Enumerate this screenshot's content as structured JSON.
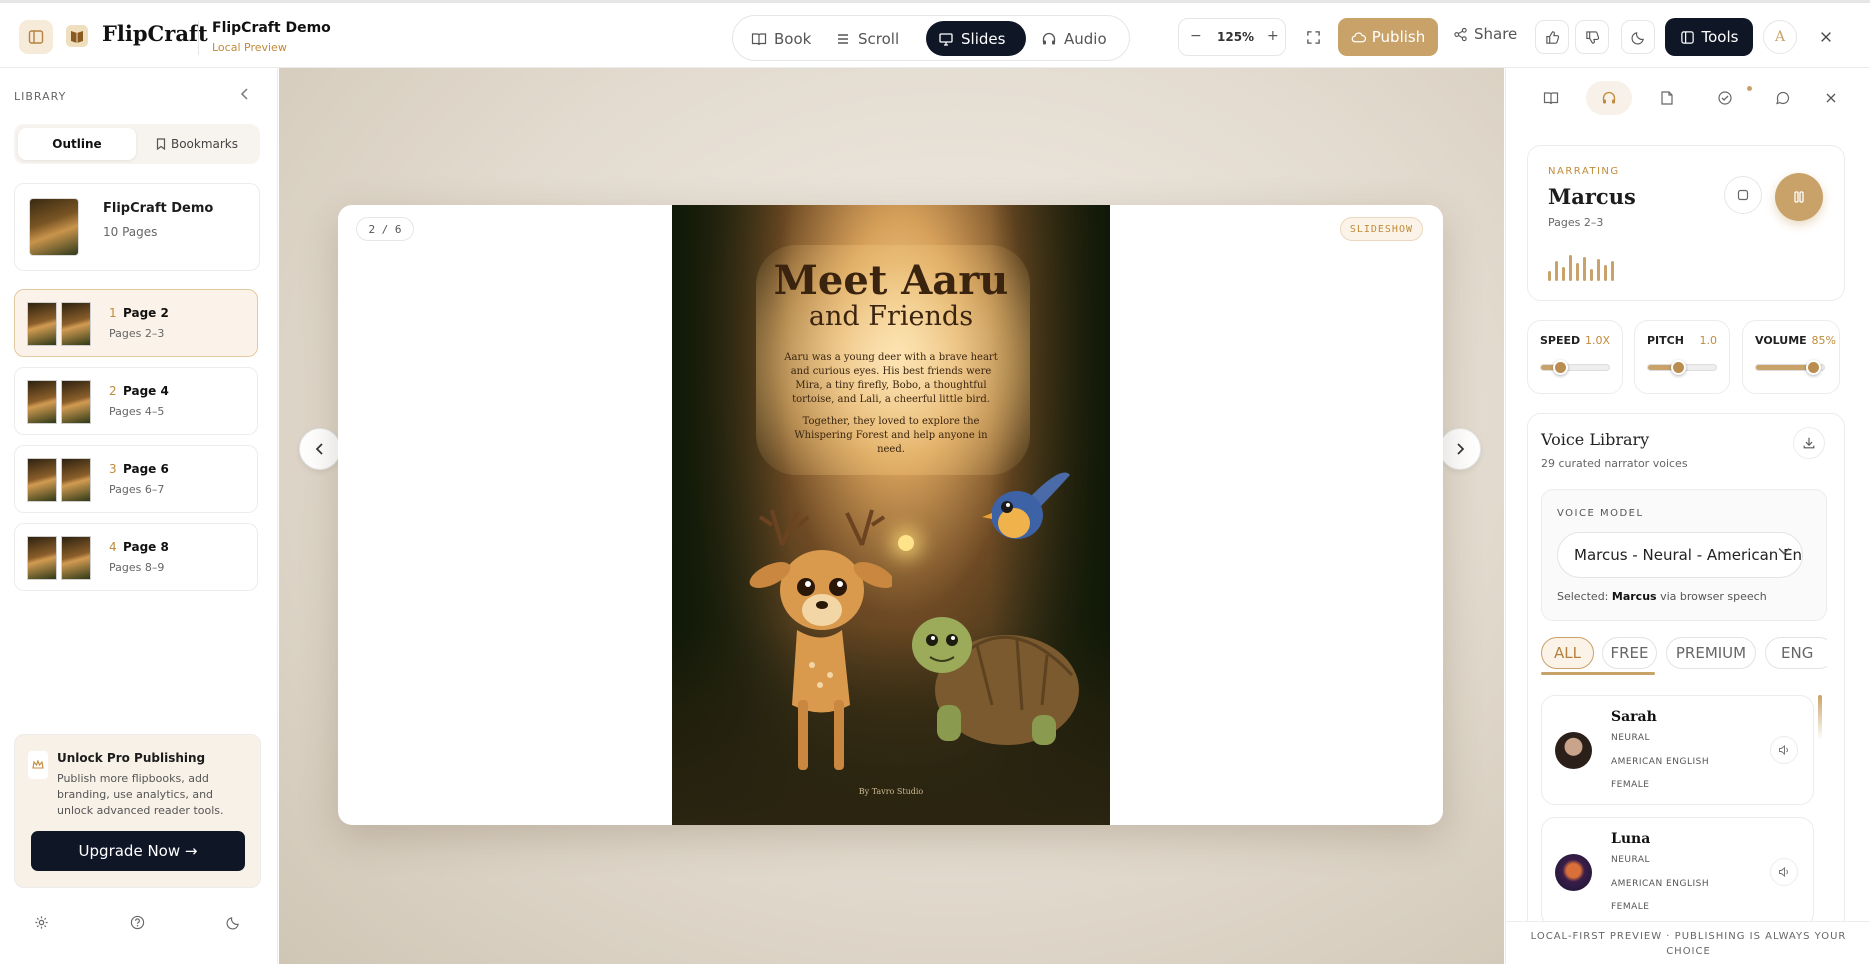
{
  "header": {
    "app_name": "FlipCraft",
    "doc_title": "FlipCraft Demo",
    "doc_subtitle": "Local Preview",
    "views": [
      {
        "label": "Book",
        "icon": "book-open-icon",
        "active": false
      },
      {
        "label": "Scroll",
        "icon": "list-icon",
        "active": false
      },
      {
        "label": "Slides",
        "icon": "monitor-icon",
        "active": true
      },
      {
        "label": "Audio",
        "icon": "headphones-icon",
        "active": false
      }
    ],
    "zoom": "125%",
    "publish_label": "Publish",
    "share_label": "Share",
    "tools_label": "Tools",
    "avatar_initial": "A"
  },
  "sidebar": {
    "section_label": "LIBRARY",
    "tabs": [
      {
        "label": "Outline",
        "active": true
      },
      {
        "label": "Bookmarks",
        "active": false
      }
    ],
    "book": {
      "title": "FlipCraft Demo",
      "pages": "10 Pages"
    },
    "pages": [
      {
        "num": "1",
        "title": "Page 2",
        "range": "Pages 2–3",
        "active": true
      },
      {
        "num": "2",
        "title": "Page 4",
        "range": "Pages 4–5",
        "active": false
      },
      {
        "num": "3",
        "title": "Page 6",
        "range": "Pages 6–7",
        "active": false
      },
      {
        "num": "4",
        "title": "Page 8",
        "range": "Pages 8–9",
        "active": false
      }
    ],
    "promo": {
      "title": "Unlock Pro Publishing",
      "body": "Publish more flipbooks, add branding, use analytics, and unlock advanced reader tools.",
      "cta": "Upgrade Now →"
    }
  },
  "stage": {
    "counter": "2 / 6",
    "mode_tag": "SLIDESHOW",
    "page": {
      "title_line1": "Meet Aaru",
      "title_line2": "and Friends",
      "body1": "Aaru was a young deer with a brave heart and curious eyes. His best friends were Mira, a tiny firefly, Bobo, a thoughtful tortoise, and Lali, a cheerful little bird.",
      "body2": "Together, they loved to explore the Whispering Forest and help anyone in need.",
      "credit": "By Tavro Studio"
    }
  },
  "panel": {
    "narrating": {
      "label": "NARRATING",
      "voice": "Marcus",
      "pages": "Pages 2–3"
    },
    "controls": [
      {
        "label": "SPEED",
        "value": "1.0X",
        "level": 0.3
      },
      {
        "label": "PITCH",
        "value": "1.0",
        "level": 0.45
      },
      {
        "label": "VOLUME",
        "value": "85%",
        "level": 0.85
      }
    ],
    "library": {
      "title": "Voice Library",
      "subtitle": "29 curated narrator voices",
      "model_label": "VOICE MODEL",
      "model_value": "Marcus - Neural - American English",
      "selected_prefix": "Selected: ",
      "selected_name": "Marcus",
      "selected_suffix": " via browser speech",
      "filters": [
        "ALL",
        "FREE",
        "PREMIUM",
        "ENG"
      ],
      "voices": [
        {
          "name": "Sarah",
          "tags": [
            "NEURAL",
            "AMERICAN ENGLISH",
            "FEMALE"
          ]
        },
        {
          "name": "Luna",
          "tags": [
            "NEURAL",
            "AMERICAN ENGLISH",
            "FEMALE"
          ]
        }
      ]
    },
    "footer_line1": "LOCAL-FIRST PREVIEW · PUBLISHING IS ALWAYS YOUR",
    "footer_line2": "CHOICE"
  },
  "colors": {
    "accent": "#c9a26a",
    "dark": "#0f1727"
  }
}
